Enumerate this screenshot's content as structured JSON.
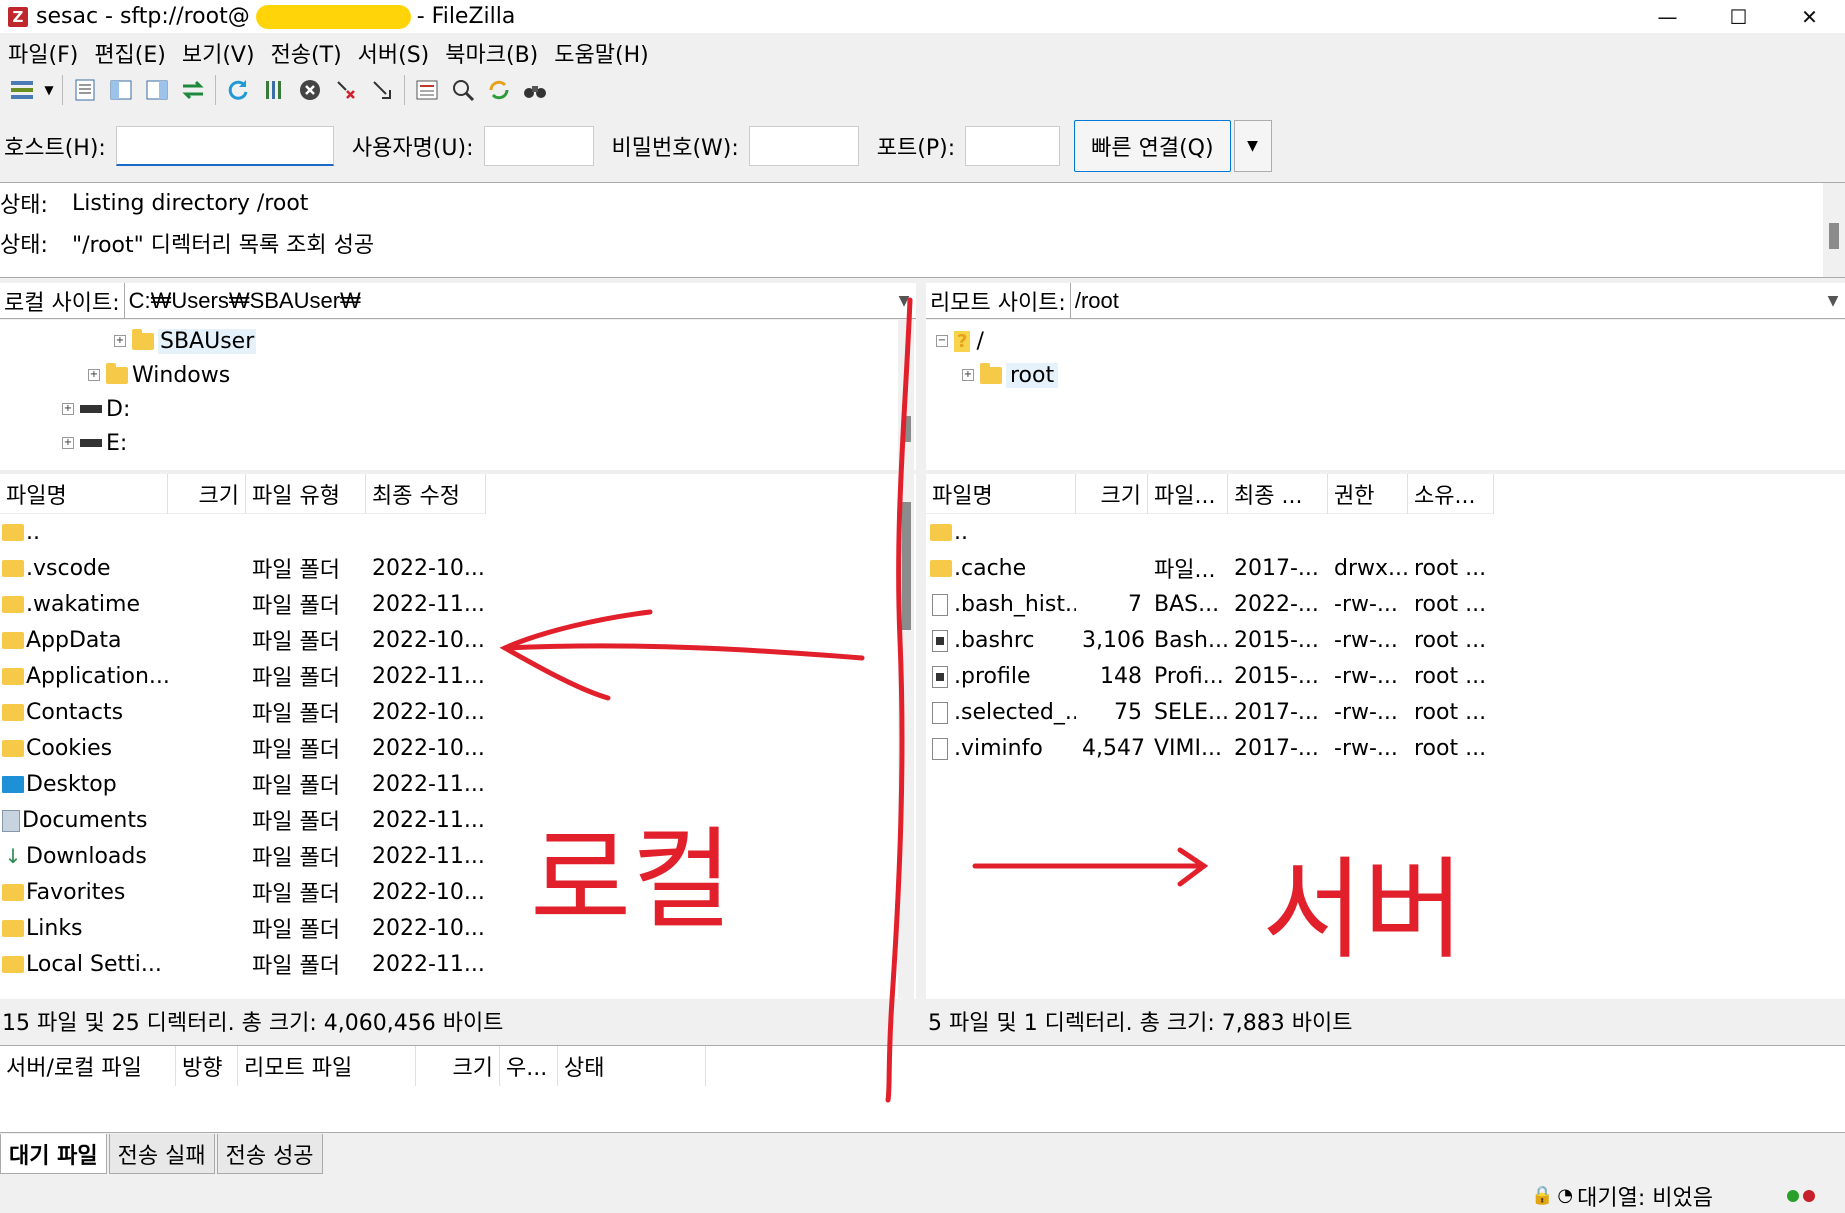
{
  "window": {
    "title_prefix": "sesac - sftp://root@",
    "title_suffix": "- FileZilla",
    "controls": [
      "—",
      "☐",
      "✕"
    ]
  },
  "menu": [
    "파일(F)",
    "편집(E)",
    "보기(V)",
    "전송(T)",
    "서버(S)",
    "북마크(B)",
    "도움말(H)"
  ],
  "quickconnect": {
    "host_label": "호스트(H):",
    "user_label": "사용자명(U):",
    "pass_label": "비밀번호(W):",
    "port_label": "포트(P):",
    "connect_label": "빠른 연결(Q)",
    "host_value": "",
    "user_value": "",
    "pass_value": "",
    "port_value": ""
  },
  "log": [
    {
      "key": "상태:",
      "text": "Listing directory /root"
    },
    {
      "key": "상태:",
      "text": "\"/root\" 디렉터리 목록 조회 성공"
    }
  ],
  "local": {
    "site_label": "로컬 사이트:",
    "path": "C:₩Users₩SBAUser₩",
    "tree": [
      {
        "label": "SBAUser",
        "type": "folder"
      },
      {
        "label": "Windows",
        "type": "folder"
      },
      {
        "label": "D:",
        "type": "drive"
      },
      {
        "label": "E:",
        "type": "drive"
      }
    ],
    "columns": {
      "name": "파일명",
      "size": "크기",
      "type": "파일 유형",
      "modified": "최종 수정"
    },
    "files": [
      {
        "name": "..",
        "type": "",
        "modified": "",
        "icon": "folder"
      },
      {
        "name": ".vscode",
        "type": "파일 폴더",
        "modified": "2022-10...",
        "icon": "folder"
      },
      {
        "name": ".wakatime",
        "type": "파일 폴더",
        "modified": "2022-11...",
        "icon": "folder"
      },
      {
        "name": "AppData",
        "type": "파일 폴더",
        "modified": "2022-10...",
        "icon": "folder"
      },
      {
        "name": "Application...",
        "type": "파일 폴더",
        "modified": "2022-11...",
        "icon": "folder"
      },
      {
        "name": "Contacts",
        "type": "파일 폴더",
        "modified": "2022-10...",
        "icon": "folder"
      },
      {
        "name": "Cookies",
        "type": "파일 폴더",
        "modified": "2022-10...",
        "icon": "folder"
      },
      {
        "name": "Desktop",
        "type": "파일 폴더",
        "modified": "2022-11...",
        "icon": "desktop"
      },
      {
        "name": "Documents",
        "type": "파일 폴더",
        "modified": "2022-11...",
        "icon": "docs"
      },
      {
        "name": "Downloads",
        "type": "파일 폴더",
        "modified": "2022-11...",
        "icon": "down"
      },
      {
        "name": "Favorites",
        "type": "파일 폴더",
        "modified": "2022-10...",
        "icon": "folder"
      },
      {
        "name": "Links",
        "type": "파일 폴더",
        "modified": "2022-10...",
        "icon": "folder"
      },
      {
        "name": "Local Setti...",
        "type": "파일 폴더",
        "modified": "2022-11...",
        "icon": "folder"
      }
    ],
    "status": "15 파일 및 25 디렉터리. 총 크기: 4,060,456 바이트"
  },
  "remote": {
    "site_label": "리모트 사이트:",
    "path": "/root",
    "tree": [
      {
        "label": "/",
        "type": "unknown"
      },
      {
        "label": "root",
        "type": "folder"
      }
    ],
    "columns": {
      "name": "파일명",
      "size": "크기",
      "type": "파일...",
      "modified": "최종 ...",
      "perm": "권한",
      "owner": "소유..."
    },
    "files": [
      {
        "name": "..",
        "size": "",
        "type": "",
        "modified": "",
        "perm": "",
        "owner": "",
        "icon": "folder"
      },
      {
        "name": ".cache",
        "size": "",
        "type": "파일...",
        "modified": "2017-...",
        "perm": "drwx...",
        "owner": "root ...",
        "icon": "folder"
      },
      {
        "name": ".bash_hist...",
        "size": "7",
        "type": "BAS...",
        "modified": "2022-...",
        "perm": "-rw-...",
        "owner": "root ...",
        "icon": "file"
      },
      {
        "name": ".bashrc",
        "size": "3,106",
        "type": "Bash...",
        "modified": "2015-...",
        "perm": "-rw-...",
        "owner": "root ...",
        "icon": "script"
      },
      {
        "name": ".profile",
        "size": "148",
        "type": "Profi...",
        "modified": "2015-...",
        "perm": "-rw-...",
        "owner": "root ...",
        "icon": "script"
      },
      {
        "name": ".selected_...",
        "size": "75",
        "type": "SELE...",
        "modified": "2017-...",
        "perm": "-rw-...",
        "owner": "root ...",
        "icon": "file"
      },
      {
        "name": ".viminfo",
        "size": "4,547",
        "type": "VIMI...",
        "modified": "2017-...",
        "perm": "-rw-...",
        "owner": "root ...",
        "icon": "file"
      }
    ],
    "status": "5 파일 및 1 디렉터리. 총 크기: 7,883 바이트"
  },
  "queue": {
    "columns": [
      "서버/로컬 파일",
      "방향",
      "리모트 파일",
      "크기",
      "우...",
      "상태"
    ],
    "tabs": [
      "대기 파일",
      "전송 실패",
      "전송 성공"
    ],
    "footer": "대기열: 비었음"
  },
  "annotations": {
    "local_label": "로컬",
    "server_label": "서버",
    "color": "#e1202c"
  }
}
